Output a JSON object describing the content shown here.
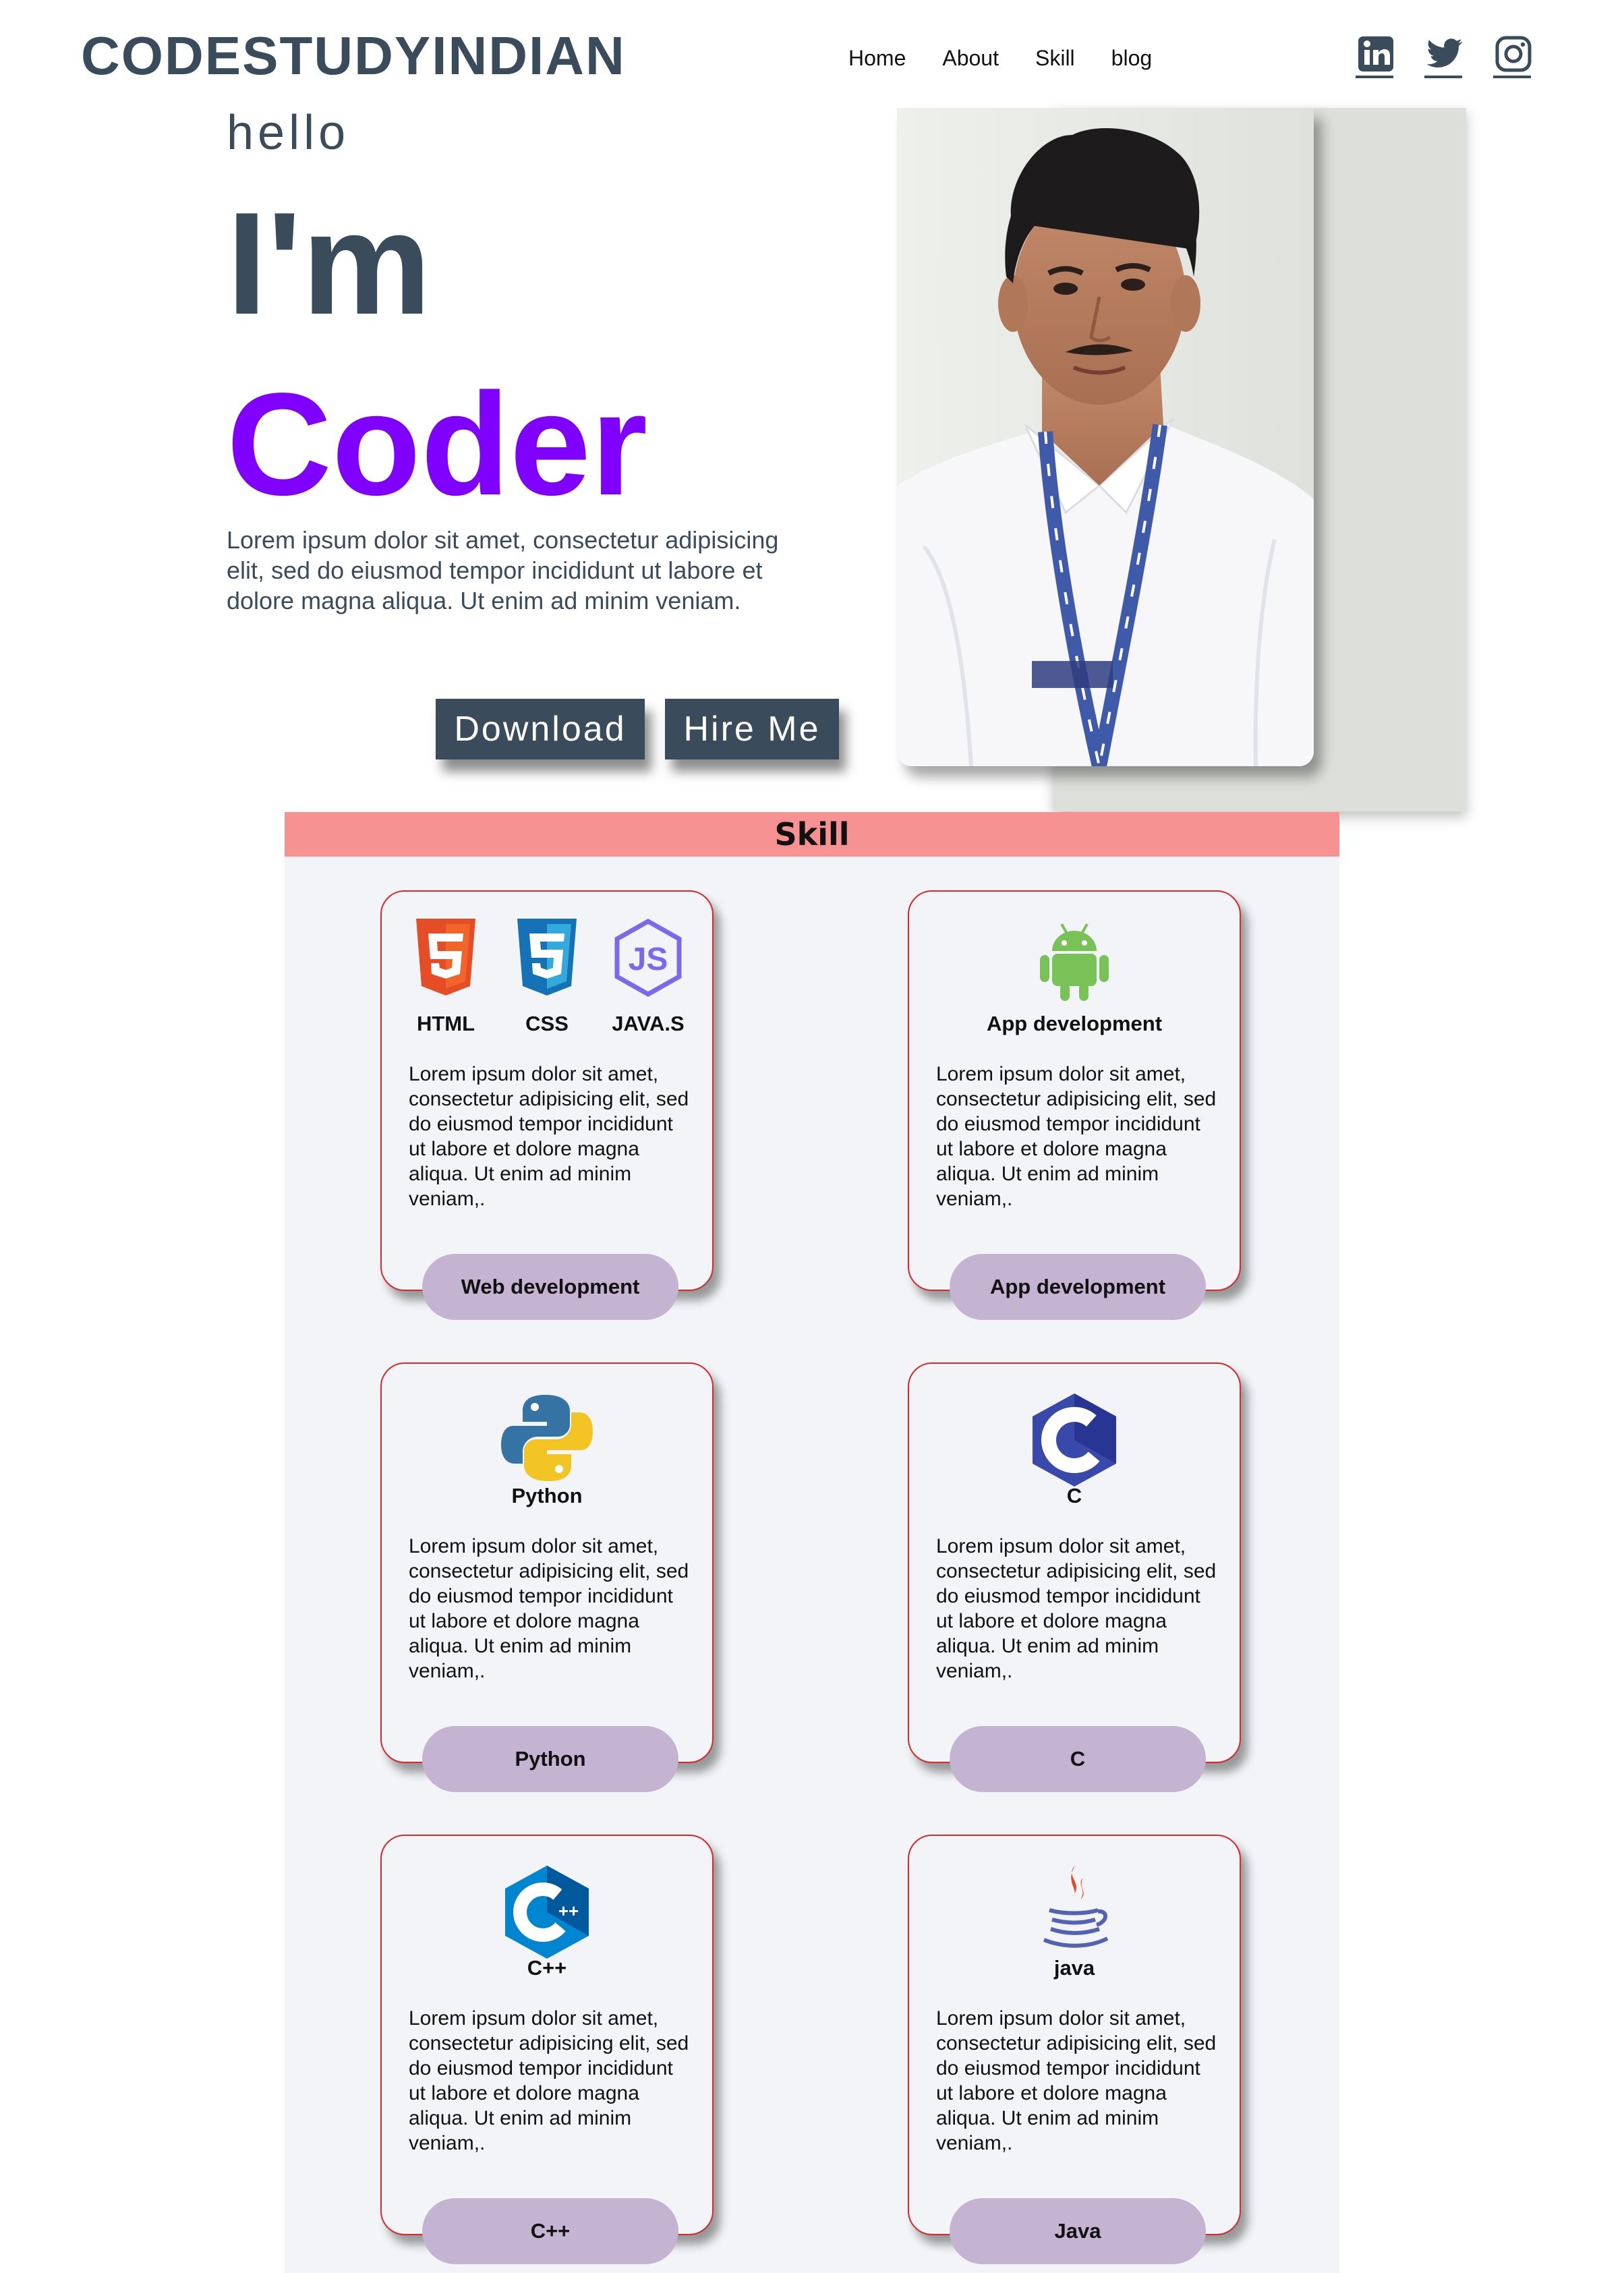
{
  "header": {
    "logo": "CODESTUDYINDIAN",
    "nav": [
      {
        "label": "Home"
      },
      {
        "label": "About"
      },
      {
        "label": "Skill"
      },
      {
        "label": "blog"
      }
    ],
    "social": [
      "linkedin-icon",
      "twitter-icon",
      "instagram-icon"
    ]
  },
  "hero": {
    "hello": "hello",
    "title_line1": "I'm",
    "title_line2": "Coder",
    "intro": "Lorem ipsum dolor sit amet, consectetur adipisicing elit, sed do eiusmod tempor incididunt ut labore et dolore magna aliqua. Ut enim ad minim veniam.",
    "download_label": "Download",
    "hire_label": "Hire Me"
  },
  "skill": {
    "heading": "Skill",
    "cards": [
      {
        "labels": [
          "HTML",
          "CSS",
          "JAVA.S"
        ],
        "icons": [
          "html5-icon",
          "css3-icon",
          "javascript-icon"
        ],
        "desc": "Lorem ipsum dolor sit amet, consectetur adipisicing elit, sed do eiusmod tempor incididunt ut labore et dolore magna aliqua. Ut enim ad minim veniam,.",
        "button": "Web development"
      },
      {
        "labels": [
          "App development"
        ],
        "icons": [
          "android-icon"
        ],
        "desc": "Lorem ipsum dolor sit amet, consectetur adipisicing elit, sed do eiusmod tempor incididunt ut labore et dolore magna aliqua. Ut enim ad minim veniam,.",
        "button": "App development"
      },
      {
        "labels": [
          "Python"
        ],
        "icons": [
          "python-icon"
        ],
        "desc": "Lorem ipsum dolor sit amet, consectetur adipisicing elit, sed do eiusmod tempor incididunt ut labore et dolore magna aliqua. Ut enim ad minim veniam,.",
        "button": "Python"
      },
      {
        "labels": [
          "C"
        ],
        "icons": [
          "c-language-icon"
        ],
        "desc": "Lorem ipsum dolor sit amet, consectetur adipisicing elit, sed do eiusmod tempor incididunt ut labore et dolore magna aliqua. Ut enim ad minim veniam,.",
        "button": "C"
      },
      {
        "labels": [
          "C++"
        ],
        "icons": [
          "cpp-icon"
        ],
        "desc": "Lorem ipsum dolor sit amet, consectetur adipisicing elit, sed do eiusmod tempor incididunt ut labore et dolore magna aliqua. Ut enim ad minim veniam,.",
        "button": "C++"
      },
      {
        "labels": [
          "java"
        ],
        "icons": [
          "java-icon"
        ],
        "desc": "Lorem ipsum dolor sit amet, consectetur adipisicing elit, sed do eiusmod tempor incididunt ut labore et dolore magna aliqua. Ut enim ad minim veniam,.",
        "button": "Java"
      }
    ]
  },
  "colors": {
    "primary": "#3a4c5c",
    "accent": "#8000ff",
    "skill_header": "#f69292",
    "pill": "#c4b3d1",
    "card_border": "#d42a2a",
    "section_bg": "#f2f4f7"
  }
}
